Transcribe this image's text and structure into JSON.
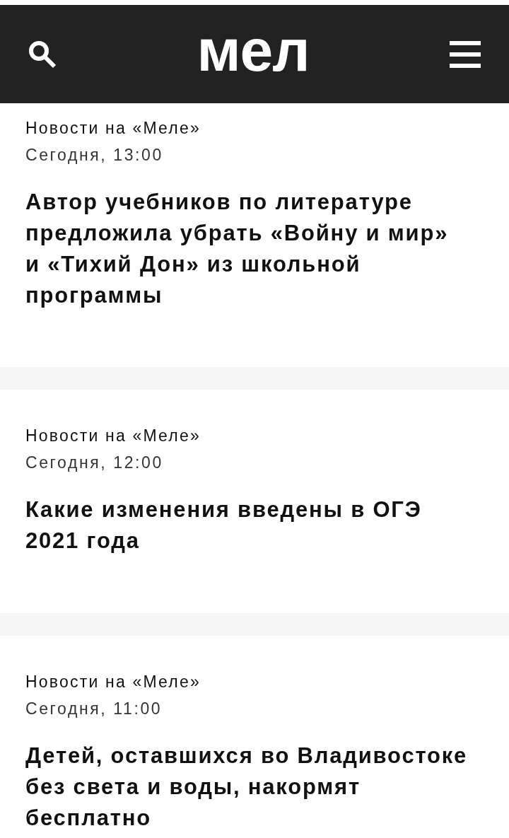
{
  "header": {
    "logo": "мел"
  },
  "articles": [
    {
      "category": "Новости на «Меле»",
      "date": "Сегодня, 13:00",
      "title": "Автор учебников по литературе предложила убрать «Войну и мир» и «Тихий Дон» из школьной программы"
    },
    {
      "category": "Новости на «Меле»",
      "date": "Сегодня, 12:00",
      "title": "Какие изменения введены в ОГЭ 2021 года"
    },
    {
      "category": "Новости на «Меле»",
      "date": "Сегодня, 11:00",
      "title": "Детей, оставшихся во Владивостоке без света и воды, накормят бесплатно"
    }
  ]
}
